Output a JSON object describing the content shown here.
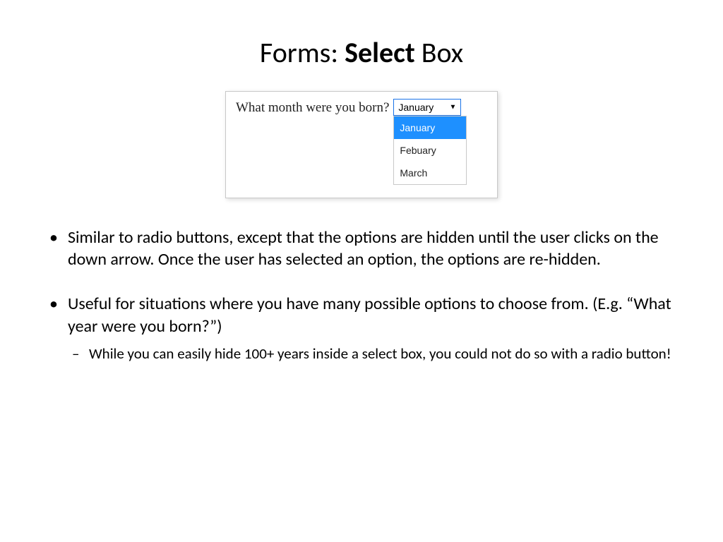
{
  "title": {
    "part1": "Forms: ",
    "bold": "Select",
    "part2": " Box"
  },
  "example": {
    "label": "What month were you born?",
    "selected_value": "January",
    "options": [
      "January",
      "Febuary",
      "March"
    ],
    "highlighted_index": 0
  },
  "bullets": [
    {
      "text": "Similar to radio buttons, except that the options are hidden until the user clicks on the down arrow.  Once the user has selected an option, the options are re-hidden.",
      "sub": []
    },
    {
      "text": "Useful for situations where you have many possible options to choose from. (E.g. “What year were you born?”)",
      "sub": [
        "While you can easily hide 100+ years inside a select box, you could not do so with a radio button!"
      ]
    }
  ]
}
